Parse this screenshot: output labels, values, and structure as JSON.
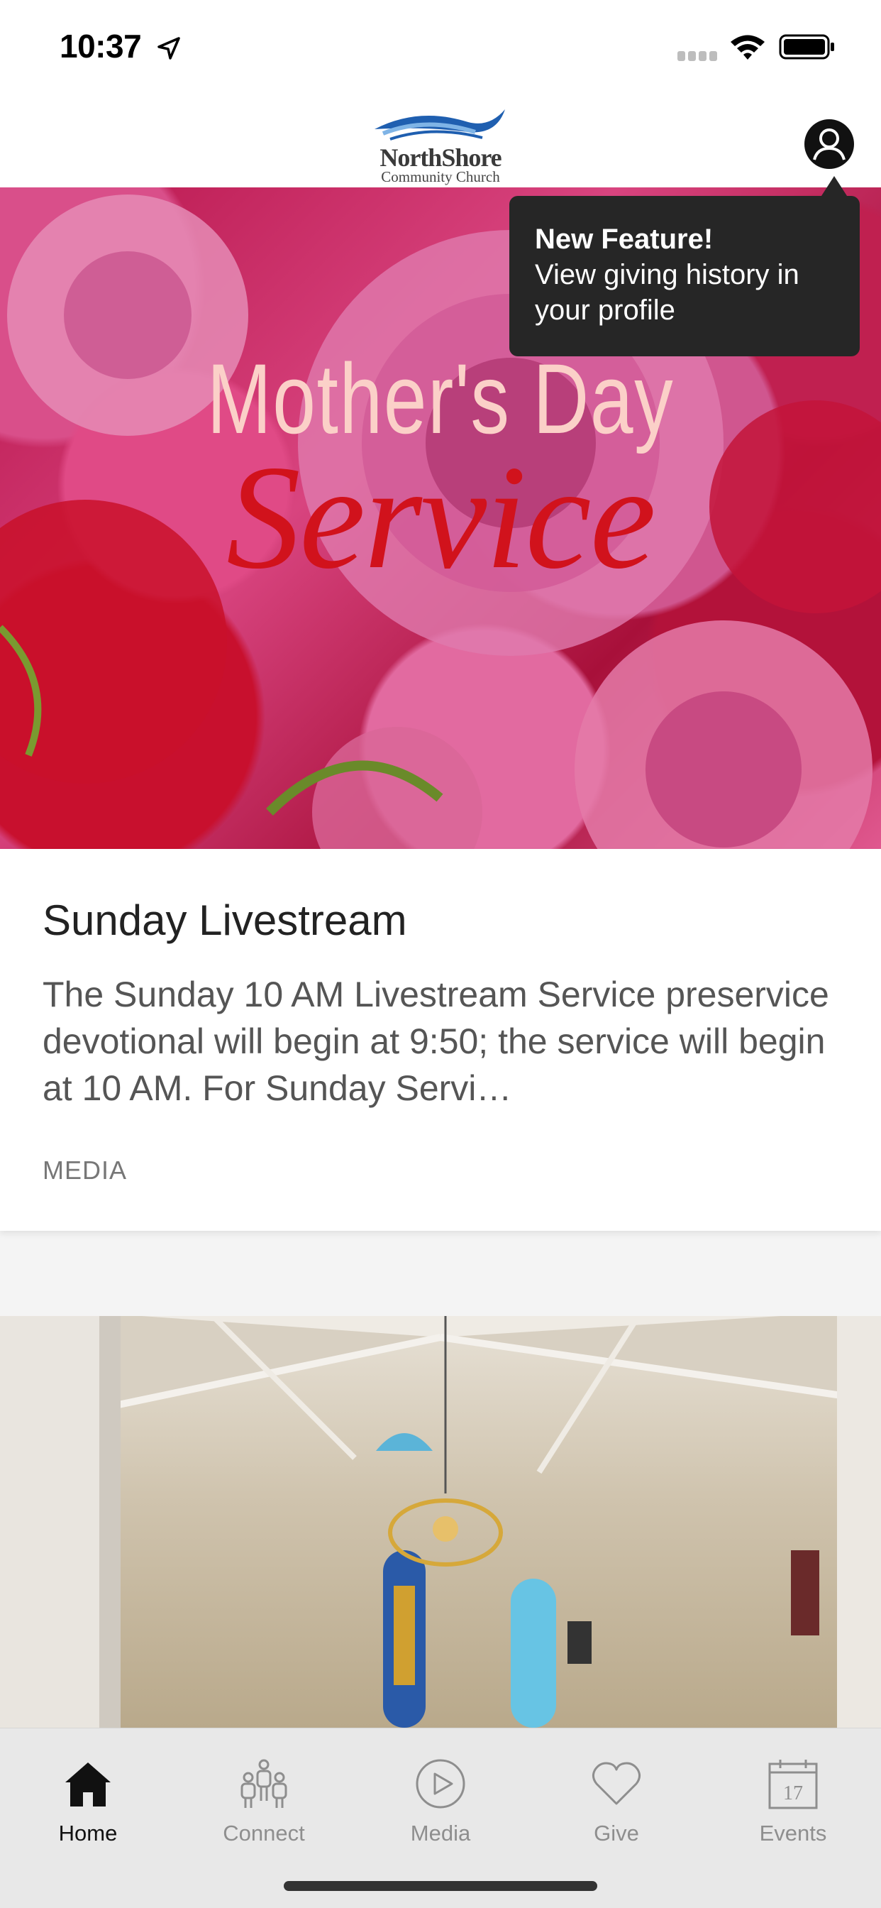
{
  "status_bar": {
    "time": "10:37"
  },
  "header": {
    "logo_name": "NorthShore",
    "logo_subtitle": "Community Church"
  },
  "tooltip": {
    "title": "New Feature!",
    "text": "View giving history in your profile"
  },
  "hero": {
    "image_text_top": "Mother's Day",
    "image_text_script": "Service",
    "title": "Sunday Livestream",
    "description": "The Sunday 10 AM Livestream Service preservice devotional will begin at 9:50; the service will begin at 10 AM. For Sunday Servi…",
    "category": "MEDIA"
  },
  "tabs": [
    {
      "label": "Home",
      "icon": "home-icon",
      "active": true
    },
    {
      "label": "Connect",
      "icon": "people-icon",
      "active": false
    },
    {
      "label": "Media",
      "icon": "play-icon",
      "active": false
    },
    {
      "label": "Give",
      "icon": "heart-icon",
      "active": false
    },
    {
      "label": "Events",
      "icon": "calendar-icon",
      "active": false,
      "calendar_day": "17"
    }
  ],
  "colors": {
    "accent_active": "#111111",
    "tab_inactive": "#8e8e8e",
    "tooltip_bg": "#262626",
    "logo_blue": "#1f5fb0"
  }
}
